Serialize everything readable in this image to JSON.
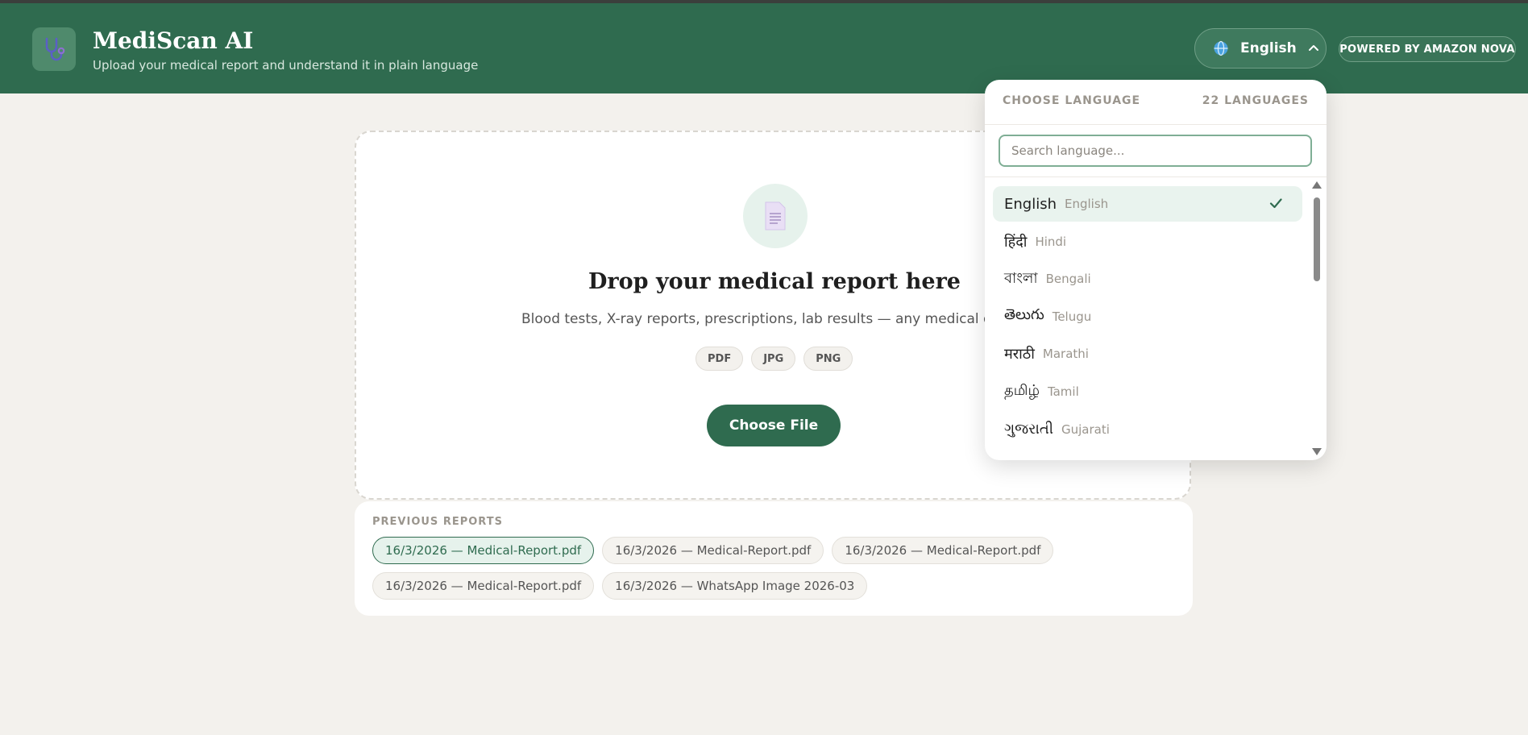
{
  "header": {
    "logo_icon": "stethoscope-icon",
    "title": "MediScan AI",
    "subtitle": "Upload your medical report and understand it in plain language",
    "language_button": {
      "icon": "globe-icon",
      "label": "English",
      "chevron": "chevron-up-icon"
    },
    "powered_badge": "POWERED BY AMAZON NOVA"
  },
  "upload": {
    "icon": "document-icon",
    "title": "Drop your medical report here",
    "description": "Blood tests, X-ray reports, prescriptions, lab results — any medical doc",
    "file_types": [
      "PDF",
      "JPG",
      "PNG"
    ],
    "choose_button": "Choose File"
  },
  "previous_reports": {
    "label": "PREVIOUS REPORTS",
    "items": [
      "16/3/2026 — Medical-Report.pdf",
      "16/3/2026 — Medical-Report.pdf",
      "16/3/2026 — Medical-Report.pdf",
      "16/3/2026 — Medical-Report.pdf",
      "16/3/2026 — WhatsApp Image 2026-03"
    ],
    "active_index": 0
  },
  "language_dropdown": {
    "title": "CHOOSE LANGUAGE",
    "count": "22 LANGUAGES",
    "search_placeholder": "Search language...",
    "selected_index": 0,
    "languages": [
      {
        "native": "English",
        "english": "English"
      },
      {
        "native": "हिंदी",
        "english": "Hindi"
      },
      {
        "native": "বাংলা",
        "english": "Bengali"
      },
      {
        "native": "తెలుగు",
        "english": "Telugu"
      },
      {
        "native": "मराठी",
        "english": "Marathi"
      },
      {
        "native": "தமிழ்",
        "english": "Tamil"
      },
      {
        "native": "ગુજરાતી",
        "english": "Gujarati"
      }
    ]
  },
  "colors": {
    "brand_green": "#2f6b4f",
    "page_bg": "#f3f1ed",
    "accent_light": "#e6f2ec"
  }
}
